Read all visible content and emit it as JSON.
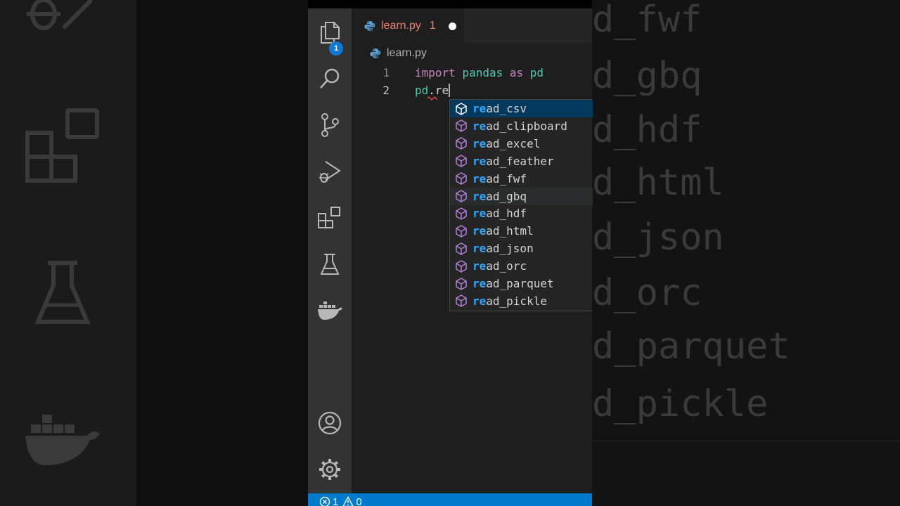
{
  "editor": {
    "tab": {
      "filename": "learn.py",
      "problem_count": "1"
    },
    "breadcrumb": "learn.py",
    "line_numbers": [
      "1",
      "2"
    ],
    "line1": {
      "keyword_import": "import",
      "module": "pandas",
      "keyword_as": "as",
      "alias": "pd"
    },
    "line2": {
      "object": "pd",
      "dot": ".",
      "typed": "re"
    }
  },
  "activity_bar": {
    "explorer_badge": "1",
    "icons": [
      "files-icon",
      "search-icon",
      "source-control-icon",
      "run-debug-icon",
      "extensions-icon",
      "testing-icon",
      "docker-icon",
      "account-icon",
      "settings-gear-icon"
    ]
  },
  "suggestions": {
    "match_prefix": "re",
    "items": [
      {
        "match": "re",
        "rest": "ad_csv"
      },
      {
        "match": "re",
        "rest": "ad_clipboard"
      },
      {
        "match": "re",
        "rest": "ad_excel"
      },
      {
        "match": "re",
        "rest": "ad_feather"
      },
      {
        "match": "re",
        "rest": "ad_fwf"
      },
      {
        "match": "re",
        "rest": "ad_gbq"
      },
      {
        "match": "re",
        "rest": "ad_hdf"
      },
      {
        "match": "re",
        "rest": "ad_html"
      },
      {
        "match": "re",
        "rest": "ad_json"
      },
      {
        "match": "re",
        "rest": "ad_orc"
      },
      {
        "match": "re",
        "rest": "ad_parquet"
      },
      {
        "match": "re",
        "rest": "ad_pickle"
      }
    ],
    "selected_index": 0,
    "hover_index": 5
  },
  "statusbar": {
    "errors": "1",
    "warnings": "0"
  },
  "background_right_words": [
    "d_fwf",
    "d_gbq",
    "d_hdf",
    "d_html",
    "d_json",
    "d_orc",
    "d_parquet",
    "d_pickle"
  ],
  "colors": {
    "accent": "#007acc",
    "selected_suggestion": "#04395e",
    "match_highlight": "#2aaaff",
    "tab_error_text": "#f07f73",
    "method_icon": "#b180d7"
  }
}
